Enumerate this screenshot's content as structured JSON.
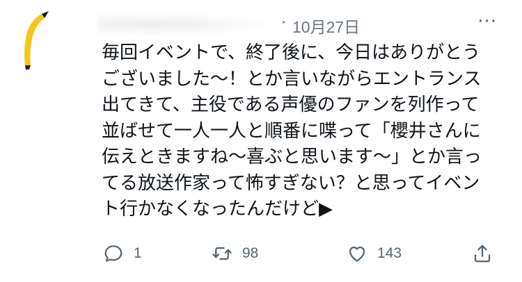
{
  "tweet": {
    "date": "10月27日",
    "more_label": "···",
    "text": "毎回イベントで、終了後に、今日はありがとう\nございました〜！とか言いながらエントランス\n出てきて、主役である声優のファンを列作って\n並ばせて一人一人と順番に喋って「櫻井さんに\n伝えときますね〜喜ぶと思います〜」とか言っ\nてる放送作家って怖すぎない？と思ってイベン\nト行かなくなったんだけど▶"
  },
  "actions": {
    "reply_count": "1",
    "retweet_count": "98",
    "like_count": "143"
  },
  "colors": {
    "text": "#0f1419",
    "muted": "#536471",
    "avatar_yellow": "#f5c518"
  }
}
